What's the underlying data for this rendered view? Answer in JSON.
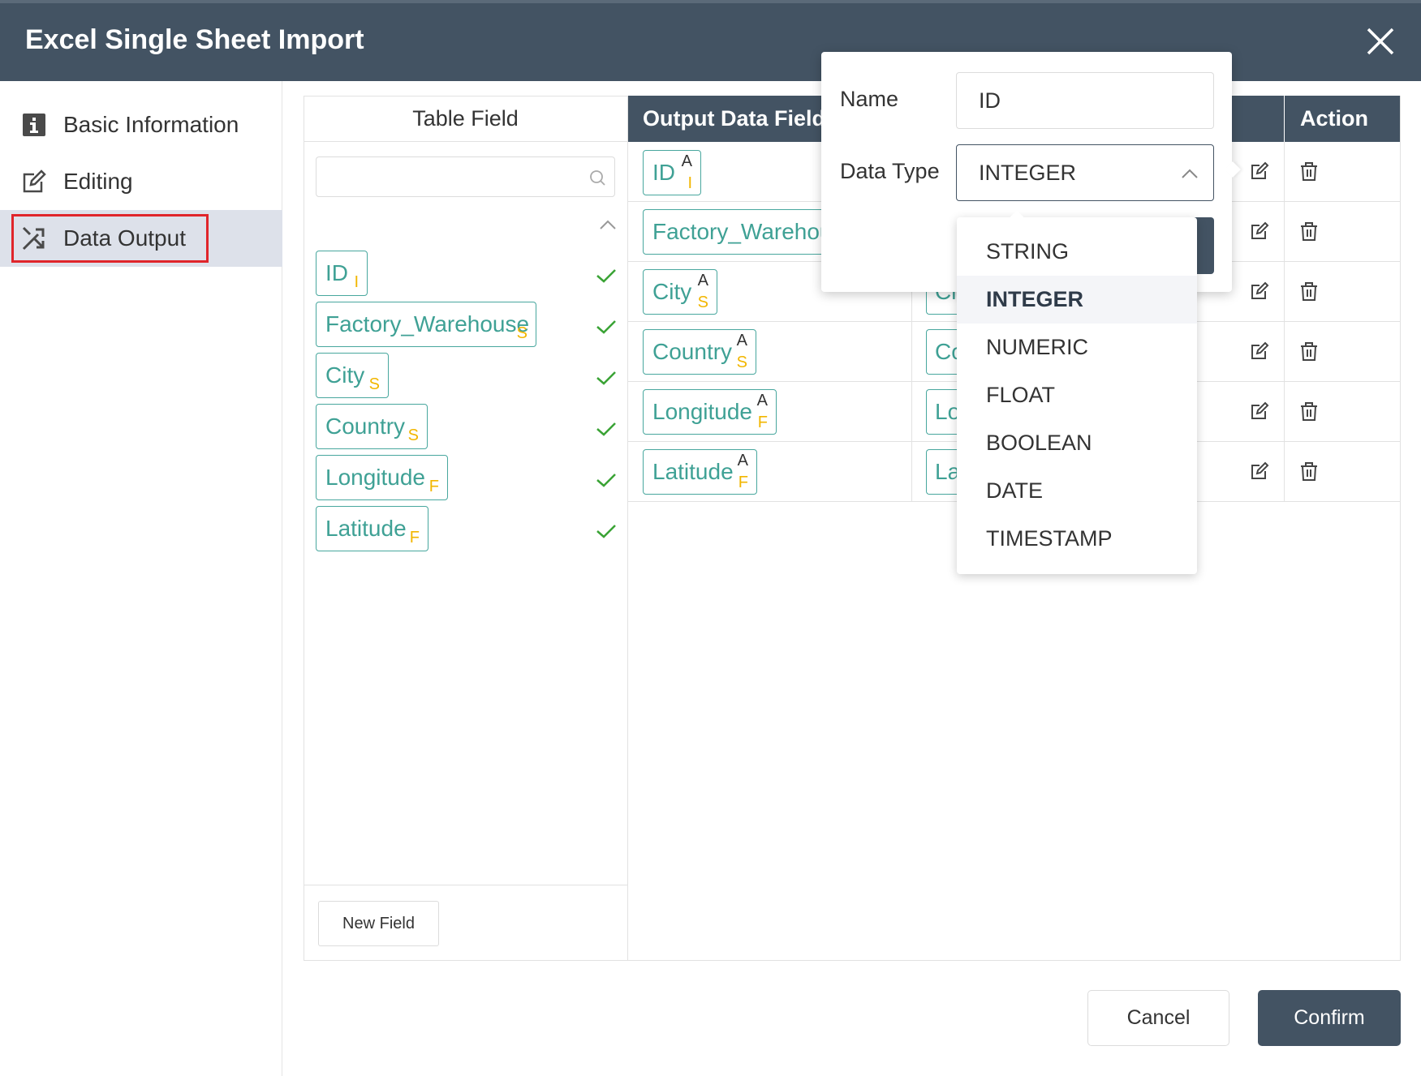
{
  "dialog": {
    "title": "Excel Single Sheet Import"
  },
  "nav": {
    "items": [
      {
        "label": "Basic Information",
        "icon": "info-icon"
      },
      {
        "label": "Editing",
        "icon": "edit-icon"
      },
      {
        "label": "Data Output",
        "icon": "shuffle-icon",
        "active": true
      }
    ]
  },
  "table_field": {
    "header": "Table Field",
    "search_placeholder": "",
    "fields": [
      {
        "name": "ID",
        "type": "I"
      },
      {
        "name": "Factory_Warehouse",
        "type": "S"
      },
      {
        "name": "City",
        "type": "S"
      },
      {
        "name": "Country",
        "type": "S"
      },
      {
        "name": "Longitude",
        "type": "F"
      },
      {
        "name": "Latitude",
        "type": "F"
      }
    ],
    "new_field_label": "New Field"
  },
  "output": {
    "header_field": "Output Data Field",
    "header_action": "Action",
    "rows": [
      {
        "name": "ID",
        "attr": "A",
        "type": "I",
        "target": ""
      },
      {
        "name": "Factory_Warehou...",
        "attr": "",
        "type": "",
        "target": ""
      },
      {
        "name": "City",
        "attr": "A",
        "type": "S",
        "target": "Ci"
      },
      {
        "name": "Country",
        "attr": "A",
        "type": "S",
        "target": "Co"
      },
      {
        "name": "Longitude",
        "attr": "A",
        "type": "F",
        "target": "Lo"
      },
      {
        "name": "Latitude",
        "attr": "A",
        "type": "F",
        "target": "La"
      }
    ]
  },
  "popover": {
    "name_label": "Name",
    "name_value": "ID",
    "type_label": "Data Type",
    "type_value": "INTEGER"
  },
  "dropdown": {
    "options": [
      "STRING",
      "INTEGER",
      "NUMERIC",
      "FLOAT",
      "BOOLEAN",
      "DATE",
      "TIMESTAMP"
    ],
    "selected": "INTEGER"
  },
  "footer": {
    "cancel_label": "Cancel",
    "confirm_label": "Confirm"
  },
  "colors": {
    "header_bg": "#435363",
    "chip_teal": "#3fa195",
    "type_badge": "#f2b600",
    "check_green": "#3aa335",
    "highlight_red": "#e0252b"
  }
}
